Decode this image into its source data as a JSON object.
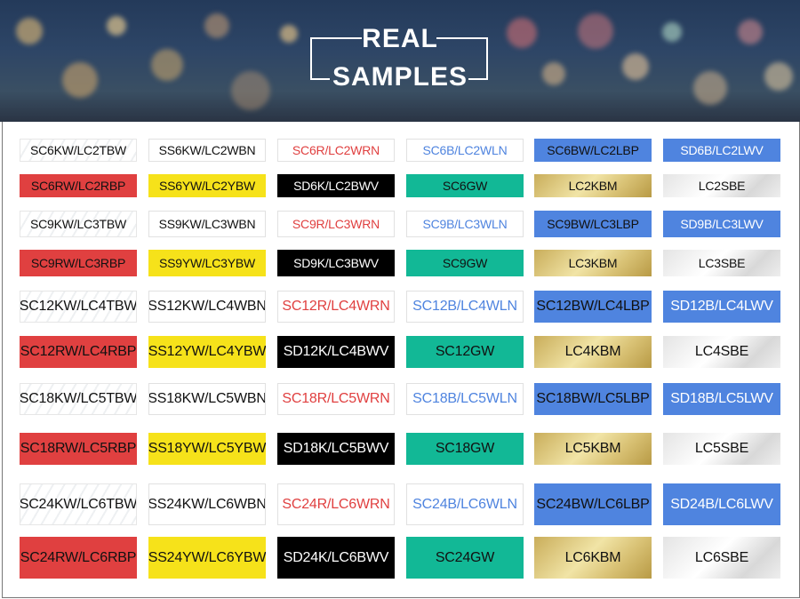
{
  "header": {
    "title_line1": "REAL",
    "title_line2": "SAMPLES"
  },
  "colors": {
    "red": "#e04040",
    "yellow": "#f6e21a",
    "black": "#000000",
    "green": "#12b896",
    "blue": "#4f84df",
    "text_red": "#e04040",
    "text_blue": "#4f84df"
  },
  "samples": [
    [
      "SC6KW/LC2TBW",
      "SS6KW/LC2WBN",
      "SC6R/LC2WRN",
      "SC6B/LC2WLN",
      "SC6BW/LC2LBP",
      "SD6B/LC2LWV"
    ],
    [
      "SC6RW/LC2RBP",
      "SS6YW/LC2YBW",
      "SD6K/LC2BWV",
      "SC6GW",
      "LC2KBM",
      "LC2SBE"
    ],
    [
      "SC9KW/LC3TBW",
      "SS9KW/LC3WBN",
      "SC9R/LC3WRN",
      "SC9B/LC3WLN",
      "SC9BW/LC3LBP",
      "SD9B/LC3LWV"
    ],
    [
      "SC9RW/LC3RBP",
      "SS9YW/LC3YBW",
      "SD9K/LC3BWV",
      "SC9GW",
      "LC3KBM",
      "LC3SBE"
    ],
    [
      "SC12KW/LC4TBW",
      "SS12KW/LC4WBN",
      "SC12R/LC4WRN",
      "SC12B/LC4WLN",
      "SC12BW/LC4LBP",
      "SD12B/LC4LWV"
    ],
    [
      "SC12RW/LC4RBP",
      "SS12YW/LC4YBW",
      "SD12K/LC4BWV",
      "SC12GW",
      "LC4KBM",
      "LC4SBE"
    ],
    [
      "SC18KW/LC5TBW",
      "SS18KW/LC5WBN",
      "SC18R/LC5WRN",
      "SC18B/LC5WLN",
      "SC18BW/LC5LBP",
      "SD18B/LC5LWV"
    ],
    [
      "SC18RW/LC5RBP",
      "SS18YW/LC5YBW",
      "SD18K/LC5BWV",
      "SC18GW",
      "LC5KBM",
      "LC5SBE"
    ],
    [
      "SC24KW/LC6TBW",
      "SS24KW/LC6WBN",
      "SC24R/LC6WRN",
      "SC24B/LC6WLN",
      "SC24BW/LC6LBP",
      "SD24B/LC6LWV"
    ],
    [
      "SC24RW/LC6RBP",
      "SS24YW/LC6YBW",
      "SD24K/LC6BWV",
      "SC24GW",
      "LC6KBM",
      "LC6SBE"
    ]
  ]
}
